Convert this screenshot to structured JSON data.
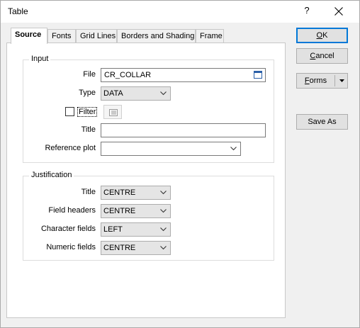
{
  "window": {
    "title": "Table",
    "help_label": "?"
  },
  "tabs": [
    {
      "label": "Source",
      "active": true
    },
    {
      "label": "Fonts",
      "active": false
    },
    {
      "label": "Grid Lines",
      "active": false
    },
    {
      "label": "Borders and Shading",
      "active": false
    },
    {
      "label": "Frame",
      "active": false
    }
  ],
  "input_group": {
    "legend": "Input",
    "file_label": "File",
    "file_value": "CR_COLLAR",
    "type_label": "Type",
    "type_value": "DATA",
    "filter_label": "Filter",
    "filter_checked": false,
    "title_label": "Title",
    "title_value": "",
    "reference_plot_label": "Reference plot",
    "reference_plot_value": ""
  },
  "justification_group": {
    "legend": "Justification",
    "title_label": "Title",
    "title_value": "CENTRE",
    "field_headers_label": "Field headers",
    "field_headers_value": "CENTRE",
    "character_fields_label": "Character fields",
    "character_fields_value": "LEFT",
    "numeric_fields_label": "Numeric fields",
    "numeric_fields_value": "CENTRE"
  },
  "buttons": {
    "ok_first": "O",
    "ok_rest": "K",
    "cancel_first": "C",
    "cancel_rest": "ancel",
    "forms_first": "F",
    "forms_rest": "orms",
    "save_as": "Save As"
  },
  "colors": {
    "accent": "#0078d7",
    "dialog_bg": "#f0f0f0",
    "panel_bg": "#ffffff"
  }
}
